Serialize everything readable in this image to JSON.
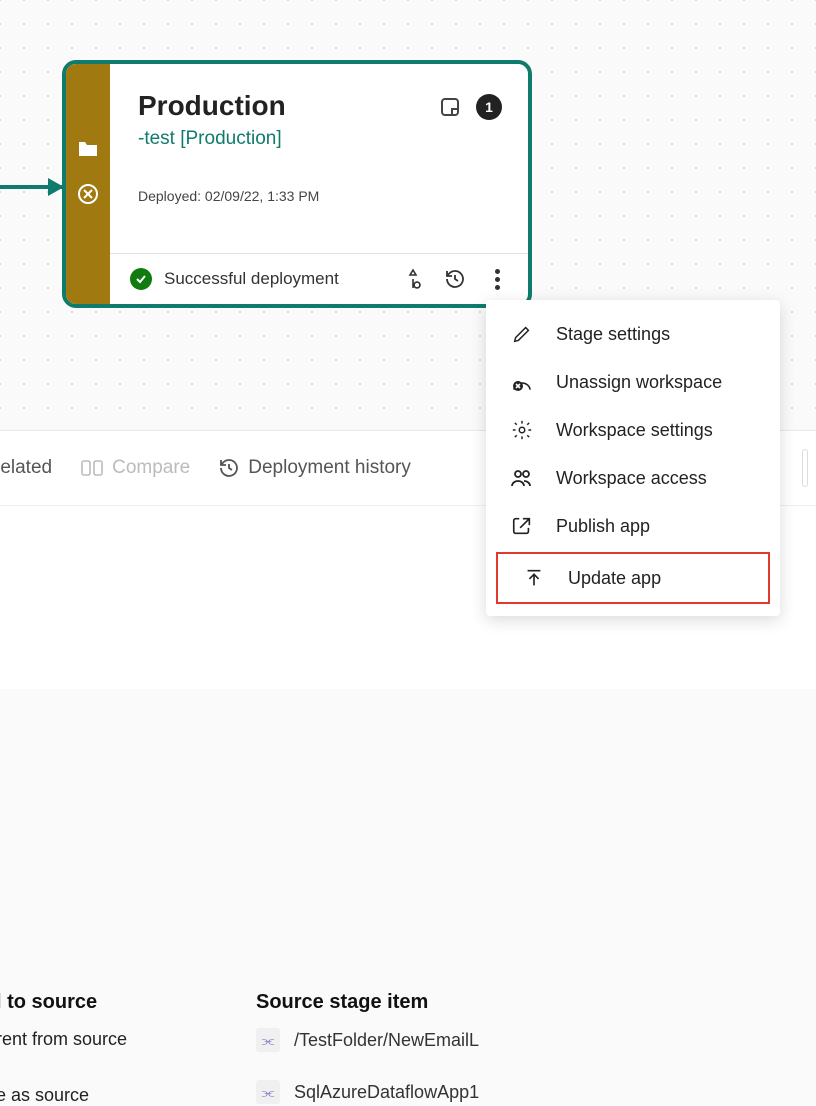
{
  "stage": {
    "title": "Production",
    "subtitle": "-test [Production]",
    "deployed_label": "Deployed: 02/09/22, 1:33 PM",
    "count": "1",
    "status_text": "Successful deployment"
  },
  "menu": {
    "stage_settings": "Stage settings",
    "unassign": "Unassign workspace",
    "ws_settings": "Workspace settings",
    "ws_access": "Workspace access",
    "publish": "Publish app",
    "update": "Update app"
  },
  "toolbar": {
    "related": "related",
    "compare": "Compare",
    "history": "Deployment history"
  },
  "columns": {
    "left_header": "l to source",
    "left_row1": "rent from source",
    "left_row2": "e as source",
    "source_header": "Source stage item",
    "items": [
      "/TestFolder/NewEmailL",
      "SqlAzureDataflowApp1"
    ]
  }
}
